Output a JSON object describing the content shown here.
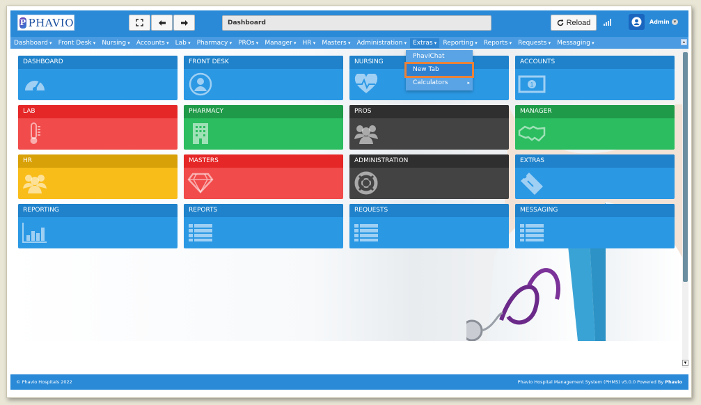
{
  "app": {
    "logo_text": "PHAVIO",
    "logo_letter": "P"
  },
  "toolbar": {
    "address": "Dashboard",
    "reload_label": "Reload",
    "user": "Admin"
  },
  "menu": [
    "Dashboard",
    "Front Desk",
    "Nursing",
    "Accounts",
    "Lab",
    "Pharmacy",
    "PROs",
    "Manager",
    "HR",
    "Masters",
    "Administration",
    "Extras",
    "Reporting",
    "Reports",
    "Requests",
    "Messaging"
  ],
  "active_menu": "Extras",
  "extras_dropdown": [
    "PhaviChat",
    "New Tab",
    "Calculators"
  ],
  "tiles": [
    {
      "label": "DASHBOARD",
      "color": "#2b98e4",
      "head": "#1f82cb",
      "icon": "speedometer-icon"
    },
    {
      "label": "FRONT DESK",
      "color": "#2b98e4",
      "head": "#1f82cb",
      "icon": "user-icon"
    },
    {
      "label": "NURSING",
      "color": "#2b98e4",
      "head": "#1f82cb",
      "icon": "heartbeat-icon"
    },
    {
      "label": "ACCOUNTS",
      "color": "#2b98e4",
      "head": "#1f82cb",
      "icon": "money-icon"
    },
    {
      "label": "LAB",
      "color": "#f14b4b",
      "head": "#e52727",
      "icon": "thermometer-icon"
    },
    {
      "label": "PHARMACY",
      "color": "#2bbd60",
      "head": "#1f9a48",
      "icon": "building-icon"
    },
    {
      "label": "PROS",
      "color": "#434343",
      "head": "#2f2f2f",
      "icon": "users-icon"
    },
    {
      "label": "MANAGER",
      "color": "#2bbd60",
      "head": "#1f9a48",
      "icon": "handshake-icon"
    },
    {
      "label": "HR",
      "color": "#f9bd1a",
      "head": "#d9a108",
      "icon": "team-icon"
    },
    {
      "label": "MASTERS",
      "color": "#f14b4b",
      "head": "#e52727",
      "icon": "diamond-icon"
    },
    {
      "label": "ADMINISTRATION",
      "color": "#434343",
      "head": "#2f2f2f",
      "icon": "lifebuoy-icon"
    },
    {
      "label": "EXTRAS",
      "color": "#2b98e4",
      "head": "#1f82cb",
      "icon": "ticket-icon"
    },
    {
      "label": "REPORTING",
      "color": "#2b98e4",
      "head": "#1f82cb",
      "icon": "bar-chart-icon"
    },
    {
      "label": "REPORTS",
      "color": "#2b98e4",
      "head": "#1f82cb",
      "icon": "list-icon"
    },
    {
      "label": "REQUESTS",
      "color": "#2b98e4",
      "head": "#1f82cb",
      "icon": "list-icon"
    },
    {
      "label": "MESSAGING",
      "color": "#2b98e4",
      "head": "#1f82cb",
      "icon": "list-icon"
    }
  ],
  "footer": {
    "left": "© Phavio Hospitals 2022",
    "right": "Phavio Hospital Management System (PHMS) v5.0.0 Powered By",
    "brand": "Phavio"
  }
}
